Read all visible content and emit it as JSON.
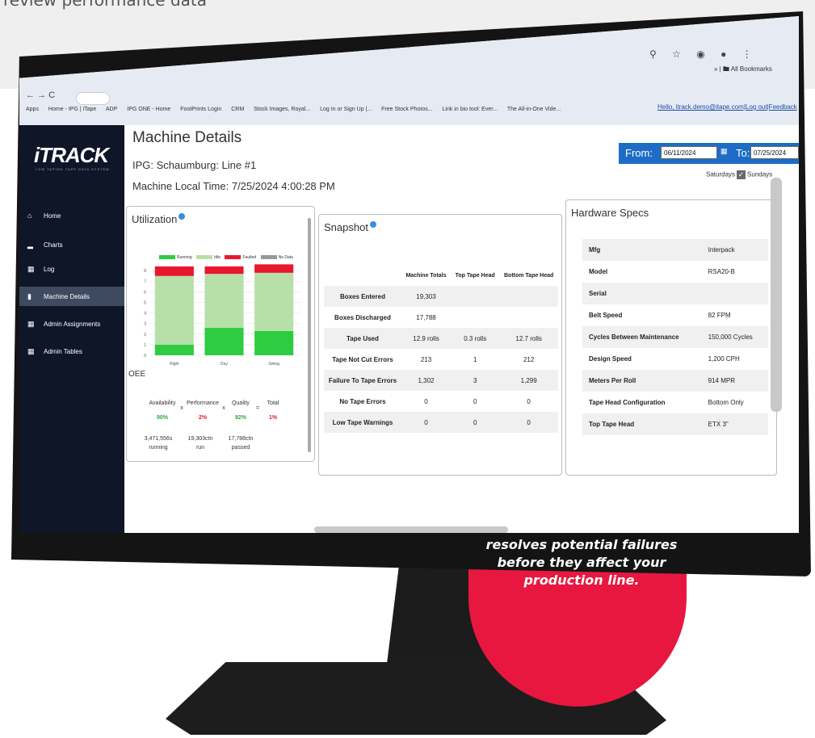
{
  "caption": "review performance data",
  "browser": {
    "nav": "←  →  C",
    "bookmarks": [
      "Apps",
      "Home - IPG | iTape",
      "ADP",
      "IPG ONE - Home",
      "FootPrints Login",
      "CRM",
      "Stock Images, Royal...",
      "Log In or Sign Up |...",
      "Free Stock Photos...",
      "Link in bio tool: Ever...",
      "The All-in-One Vide..."
    ],
    "all_bookmarks": "All Bookmarks",
    "toolbar_icons": [
      "search-icon",
      "star-icon",
      "extension-icon",
      "profile-icon",
      "menu-icon"
    ]
  },
  "hello_link": "Hello, itrack.demo@itape.com|Log out|Feedback",
  "sidebar": {
    "logo": "iTRACK",
    "logo_sub": "LOW TAPING TAPE DATA SYSTEM",
    "items": [
      {
        "icon": "home-icon",
        "label": "Home"
      },
      {
        "icon": "chart-icon",
        "label": "Charts"
      },
      {
        "icon": "log-icon",
        "label": "Log"
      },
      {
        "icon": "machine-icon",
        "label": "Machine Details"
      },
      {
        "icon": "assignments-icon",
        "label": "Admin Assignments"
      },
      {
        "icon": "tables-icon",
        "label": "Admin Tables"
      }
    ]
  },
  "page": {
    "title": "Machine Details",
    "location": "IPG: Schaumburg: Line #1",
    "local_time": "Machine Local Time: 7/25/2024 4:00:28 PM"
  },
  "date_range": {
    "from_label": "From:",
    "from_value": "06/11/2024",
    "to_label": "To:",
    "to_value": "07/25/2024",
    "saturdays": "Saturdays",
    "sundays": "Sundays"
  },
  "utilization": {
    "title": "Utilization",
    "legend": [
      "Running",
      "Idle",
      "Faulted",
      "No Data"
    ],
    "colors": {
      "running": "#2ecc40",
      "idle": "#b6e0a8",
      "faulted": "#e8172d",
      "nodata": "#999999"
    },
    "oee_label": "OEE",
    "metrics": [
      {
        "label": "Availability",
        "value": "90%",
        "color": "#2aa745"
      },
      {
        "label": "Performance",
        "value": "2%",
        "color": "#e8172d"
      },
      {
        "label": "Quality",
        "value": "92%",
        "color": "#2aa745"
      },
      {
        "label": "Total",
        "value": "1%",
        "color": "#e8172d"
      }
    ],
    "ops": [
      "x",
      "x",
      "="
    ],
    "stats": [
      {
        "value": "3,471,556s",
        "label": "running"
      },
      {
        "value": "19,303ctn",
        "label": "run"
      },
      {
        "value": "17,788ctn",
        "label": "passed"
      }
    ]
  },
  "chart_data": {
    "type": "bar",
    "categories": [
      "Night",
      "Day",
      "Swing"
    ],
    "y_ticks": [
      0,
      1,
      2,
      3,
      4,
      5,
      6,
      7,
      8
    ],
    "series": [
      {
        "name": "Running",
        "values": [
          1.0,
          2.6,
          2.3
        ]
      },
      {
        "name": "Idle",
        "values": [
          6.5,
          5.1,
          5.5
        ]
      },
      {
        "name": "Faulted",
        "values": [
          0.9,
          0.7,
          0.8
        ]
      },
      {
        "name": "No Data",
        "values": [
          0,
          0,
          0
        ]
      }
    ],
    "ylim": [
      0,
      8.4
    ],
    "stacked": true
  },
  "snapshot": {
    "title": "Snapshot",
    "columns": [
      "",
      "Machine Totals",
      "Top Tape Head",
      "Bottom Tape Head"
    ],
    "rows": [
      [
        "Boxes Entered",
        "19,303",
        "",
        ""
      ],
      [
        "Boxes Discharged",
        "17,788",
        "",
        ""
      ],
      [
        "Tape Used",
        "12.9 rolls",
        "0.3 rolls",
        "12.7 rolls"
      ],
      [
        "Tape Not Cut Errors",
        "213",
        "1",
        "212"
      ],
      [
        "Failure To Tape Errors",
        "1,302",
        "3",
        "1,299"
      ],
      [
        "No Tape Errors",
        "0",
        "0",
        "0"
      ],
      [
        "Low Tape Warnings",
        "0",
        "0",
        "0"
      ]
    ]
  },
  "hardware": {
    "title": "Hardware Specs",
    "rows": [
      [
        "Mfg",
        "Interpack"
      ],
      [
        "Model",
        "RSA20-B"
      ],
      [
        "Serial",
        ""
      ],
      [
        "Belt Speed",
        "82 FPM"
      ],
      [
        "Cycles Between Maintenance",
        "150,000 Cycles"
      ],
      [
        "Design Speed",
        "1,200 CPH"
      ],
      [
        "Meters Per Roll",
        "914 MPR"
      ],
      [
        "Tape Head Configuration",
        "Bottom Only"
      ],
      [
        "Top Tape Head",
        "ETX 3\""
      ]
    ]
  },
  "badge_text": "resolves potential failures before they affect your production line."
}
